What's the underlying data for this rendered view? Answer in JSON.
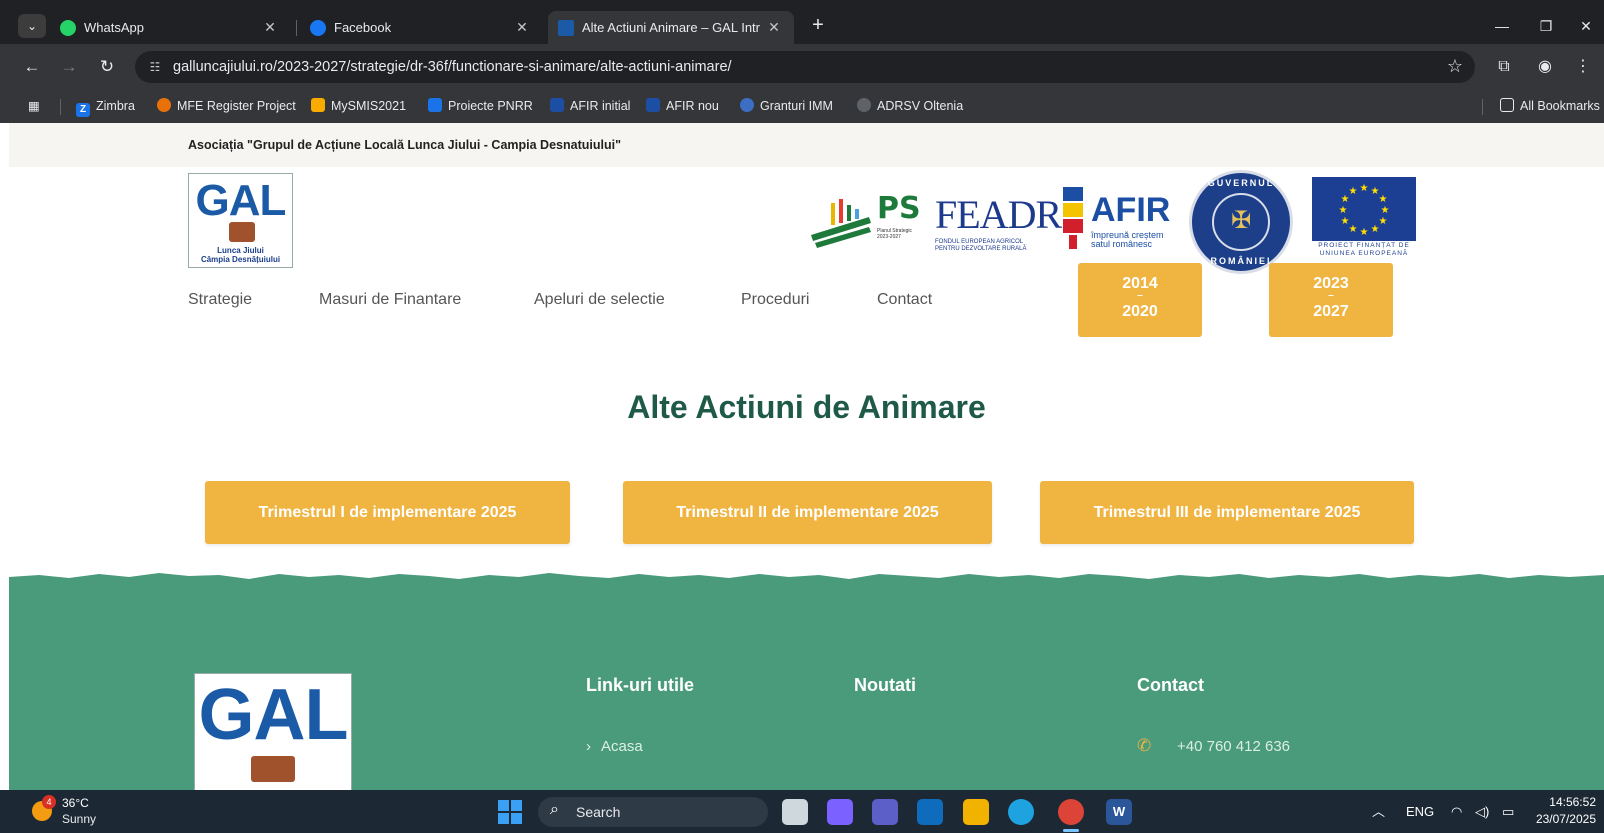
{
  "browser": {
    "tabs": [
      {
        "title": "WhatsApp",
        "icon": "whatsapp-icon"
      },
      {
        "title": "Facebook",
        "icon": "facebook-icon"
      },
      {
        "title": "Alte Actiuni Animare – GAL Intr",
        "icon": "gal-favicon"
      }
    ],
    "url": "galluncajiului.ro/2023-2027/strategie/dr-36f/functionare-si-animare/alte-actiuni-animare/",
    "bookmarks": [
      {
        "label": "Zimbra",
        "icon": "zimbra-icon",
        "color": "#1a73e8"
      },
      {
        "label": "MFE Register Project",
        "icon": "mfe-icon",
        "color": "#e8710a"
      },
      {
        "label": "MySMIS2021",
        "icon": "mysmis-icon",
        "color": "#f9ab00"
      },
      {
        "label": "Proiecte PNRR",
        "icon": "pnrr-icon",
        "color": "#1a73e8"
      },
      {
        "label": "AFIR initial",
        "icon": "afir-icon",
        "color": "#1c4ea3"
      },
      {
        "label": "AFIR nou",
        "icon": "afir-nou-icon",
        "color": "#1c4ea3"
      },
      {
        "label": "Granturi IMM",
        "icon": "granturi-icon",
        "color": "#3c6ec4"
      },
      {
        "label": "ADRSV Oltenia",
        "icon": "globe-icon",
        "color": "#5f6368"
      }
    ],
    "all_bookmarks": "All Bookmarks"
  },
  "site": {
    "association": "Asociația \"Grupul de Acțiune Locală Lunca Jiului - Campia Desnatuiului\"",
    "logo": {
      "gal": "GAL",
      "line1": "Lunca Jiului",
      "line2": "Câmpia Desnățuiului"
    },
    "partners": {
      "ps": {
        "mark": "PS",
        "sub": "Planul Strategic 2023-2027"
      },
      "feadr": {
        "mark": "FEADR",
        "sub": "FONDUL EUROPEAN AGRICOL PENTRU DEZVOLTARE RURALĂ"
      },
      "afir": {
        "mark": "AFIR",
        "sub1": "împreună creștem",
        "sub2": "satul românesc"
      },
      "gov": {
        "top": "GUVERNUL",
        "bottom": "ROMÂNIEI"
      },
      "eu": {
        "sub1": "PROIECT FINANȚAT DE",
        "sub2": "UNIUNEA EUROPEANĂ"
      }
    },
    "nav": [
      "Strategie",
      "Masuri de Finantare",
      "Apeluri de selectie",
      "Proceduri",
      "Contact"
    ],
    "periods": [
      {
        "from": "2014",
        "to": "2020"
      },
      {
        "from": "2023",
        "to": "2027"
      }
    ],
    "page_title": "Alte Actiuni de Animare",
    "trimester_buttons": [
      "Trimestrul I de implementare 2025",
      "Trimestrul II de implementare 2025",
      "Trimestrul III de implementare 2025"
    ],
    "footer": {
      "useful_links_title": "Link-uri utile",
      "news_title": "Noutati",
      "contact_title": "Contact",
      "first_link": "Acasa",
      "phone": "+40 760 412 636"
    },
    "colors": {
      "accent": "#f0b441",
      "title": "#1f5a48",
      "footer": "#4a9a7c"
    }
  },
  "taskbar": {
    "weather": {
      "temp": "36°C",
      "condition": "Sunny",
      "badge": "4"
    },
    "search": "Search",
    "language": "ENG",
    "time": "14:56:52",
    "date": "23/07/2025"
  }
}
